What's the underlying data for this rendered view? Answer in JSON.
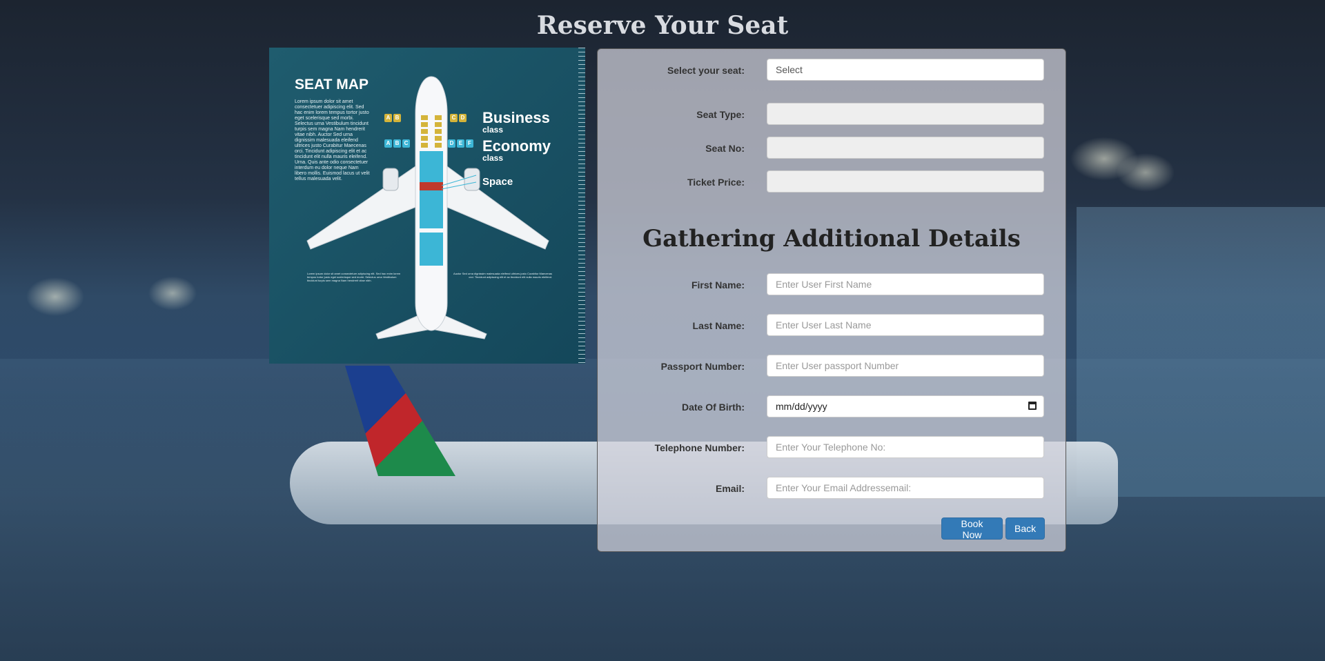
{
  "page": {
    "title": "Reserve Your Seat"
  },
  "seat_map": {
    "title": "SEAT MAP",
    "description": "Lorem ipsum dolor sit amet consectetuer adipiscing elit. Sed hac enim lorem tempus tortor justo eget scelerisque sed morbi. Selectus urna Vestibulum tincidunt turpis sem magna Nam hendrerit vitae nibh. Auctor Sed urna dignissim malesuada eleifend ultrices justo Curabitur Maecenas orci. Tincidunt adipiscing elit et ac tincidunt elit nulla mauris eleifend. Urna. Quis ante odio consectetuer interdum eu dolor neque Nam libero mollis. Euismod lacus ut velit tellus malesuada velit.",
    "footer_left": "Lorem ipsum dolor sit amet consectetuer adipiscing elit. Sed hac enim lorem tempus tortor justo eget scelerisque sed morbi. Selectus urna Vestibulum tincidunt turpis sem magna Nam hendrerit vitae nibh.",
    "footer_right": "Auctor Sed urna dignissim malesuada eleifend ultrices justo Curabitur Maecenas orci. Tincidunt adipiscing elit et ac tincidunt elit nulla mauris eleifend.",
    "legend": {
      "business": "Business",
      "business_sub": "class",
      "economy": "Economy",
      "economy_sub": "class",
      "space": "Space",
      "business_tags_left": [
        "A",
        "B"
      ],
      "business_tags_right": [
        "C",
        "D"
      ],
      "economy_tags_left": [
        "A",
        "B",
        "C"
      ],
      "economy_tags_right": [
        "D",
        "E",
        "F"
      ]
    },
    "colors": {
      "business": "#d4b43a",
      "economy": "#3cb6d6",
      "space": "#c0392b"
    }
  },
  "form": {
    "seat_select_label": "Select your seat:",
    "seat_select_value": "Select",
    "seat_type_label": "Seat Type:",
    "seat_no_label": "Seat No:",
    "ticket_price_label": "Ticket Price:",
    "section_heading": "Gathering Additional Details",
    "first_name_label": "First Name:",
    "first_name_placeholder": "Enter User First Name",
    "last_name_label": "Last Name:",
    "last_name_placeholder": "Enter User Last Name",
    "passport_label": "Passport Number:",
    "passport_placeholder": "Enter User passport Number",
    "dob_label": "Date Of Birth:",
    "dob_placeholder": "mm/dd/yyyy",
    "telephone_label": "Telephone Number:",
    "telephone_placeholder": "Enter Your Telephone No:",
    "email_label": "Email:",
    "email_placeholder": "Enter Your Email Addressemail:",
    "book_button": "Book Now",
    "back_button": "Back"
  },
  "theme": {
    "button_color": "#337ab7"
  }
}
